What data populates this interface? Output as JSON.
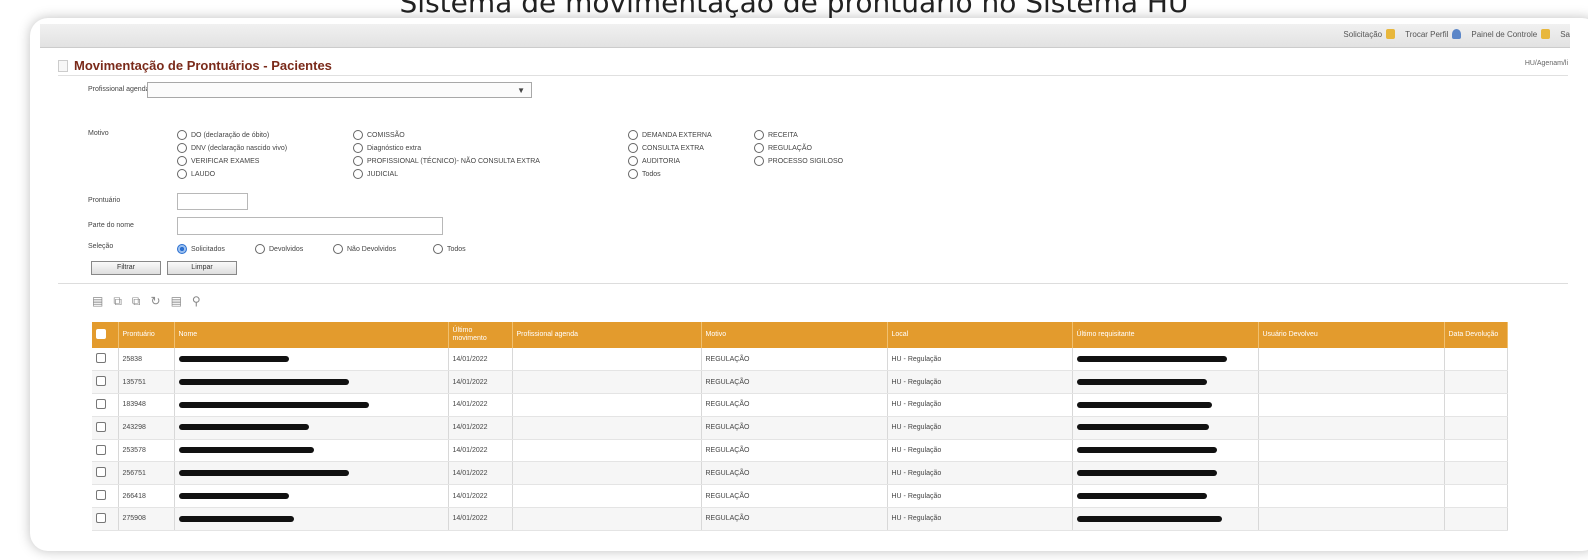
{
  "caption": "Sistema de movimentação de prontuário no Sistema HU",
  "topbar": {
    "items": [
      {
        "label": "Solicitação",
        "icon": "folder-icon"
      },
      {
        "label": "Trocar Perfil",
        "icon": "user-icon"
      },
      {
        "label": "Painel de Controle",
        "icon": "folder-icon"
      },
      {
        "label": "Sa",
        "icon": ""
      }
    ]
  },
  "page": {
    "title": "Movimentação de Prontuários - Pacientes",
    "user": "HU/Agenam/li"
  },
  "form": {
    "profissional_label": "Profissional agenda",
    "motivo_label": "Motivo",
    "motivos": [
      "DO (declaração de óbito)",
      "DNV (declaração nascido vivo)",
      "VERIFICAR EXAMES",
      "LAUDO",
      "COMISSÃO",
      "Diagnóstico extra",
      "PROFISSIONAL (TÉCNICO)- NÃO CONSULTA EXTRA",
      "JUDICIAL",
      "DEMANDA EXTERNA",
      "CONSULTA EXTRA",
      "AUDITORIA",
      "Todos",
      "RECEITA",
      "REGULAÇÃO",
      "PROCESSO SIGILOSO"
    ],
    "prontuario_label": "Prontuário",
    "parte_nome_label": "Parte do nome",
    "selecao_label": "Seleção",
    "selecao_options": [
      "Solicitados",
      "Devolvidos",
      "Não Devolvidos",
      "Todos"
    ],
    "filtrar_button": "Filtrar",
    "limpar_button": "Limpar"
  },
  "toolbar_icons": [
    "search-doc-icon",
    "copy-icon",
    "copy-back-icon",
    "refresh-icon",
    "print-icon",
    "zoom-icon"
  ],
  "table": {
    "headers": [
      "Prontuário",
      "Nome",
      "Último movimento",
      "Profissional agenda",
      "Motivo",
      "Local",
      "Último requisitante",
      "Usuário Devolveu",
      "Data Devolução"
    ],
    "rows": [
      {
        "prontuario": "25838",
        "data": "14/01/2022",
        "motivo": "REGULAÇÃO",
        "local": "HU - Regulação"
      },
      {
        "prontuario": "135751",
        "data": "14/01/2022",
        "motivo": "REGULAÇÃO",
        "local": "HU - Regulação"
      },
      {
        "prontuario": "183948",
        "data": "14/01/2022",
        "motivo": "REGULAÇÃO",
        "local": "HU - Regulação"
      },
      {
        "prontuario": "243298",
        "data": "14/01/2022",
        "motivo": "REGULAÇÃO",
        "local": "HU - Regulação"
      },
      {
        "prontuario": "253578",
        "data": "14/01/2022",
        "motivo": "REGULAÇÃO",
        "local": "HU - Regulação"
      },
      {
        "prontuario": "256751",
        "data": "14/01/2022",
        "motivo": "REGULAÇÃO",
        "local": "HU - Regulação"
      },
      {
        "prontuario": "266418",
        "data": "14/01/2022",
        "motivo": "REGULAÇÃO",
        "local": "HU - Regulação"
      },
      {
        "prontuario": "275908",
        "data": "14/01/2022",
        "motivo": "REGULAÇÃO",
        "local": "HU - Regulação"
      }
    ]
  }
}
